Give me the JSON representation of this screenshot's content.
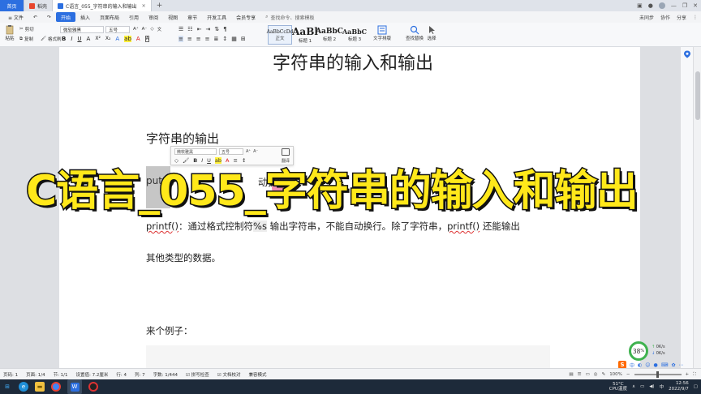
{
  "tabs": {
    "home": "首页",
    "docer": "稻壳",
    "document": "C语言_055_字符串的输入和输出",
    "new_tab": "+"
  },
  "menu": {
    "file": "≡ 文件",
    "start": "开始",
    "items": [
      "插入",
      "页面布局",
      "引用",
      "审阅",
      "视图",
      "章节",
      "开发工具",
      "会员专享"
    ],
    "search_placeholder": "查找命令、搜索模板",
    "right": [
      "未同步",
      "协作",
      "分享"
    ]
  },
  "ribbon": {
    "paste": "粘贴",
    "cut": "剪切",
    "copy": "复制",
    "format_painter": "格式刷",
    "font_name": "微软雅黑",
    "font_size": "五号",
    "styles": [
      {
        "preview": "AaBbCcDd",
        "label": "正文"
      },
      {
        "preview": "AaBl",
        "label": "标题 1"
      },
      {
        "preview": "AaBbC",
        "label": "标题 2"
      },
      {
        "preview": "AaBbC",
        "label": "标题 3"
      }
    ],
    "text_layout": "文字排版",
    "find_replace": "查找替换",
    "select": "选择"
  },
  "document": {
    "title": "字符串的输入和输出",
    "heading": "字符串的输出",
    "puts_line_start": "puts()",
    "puts_line_end": "动换行",
    "printf_line": {
      "func": "printf()",
      "rest_a": "：通过格式控制符",
      "spec": "%s",
      "rest_b": " 输出字符串，不能自动换行。除了字符串，",
      "func2": "printf()",
      "rest_c": " 还能输出"
    },
    "other_types": "其他类型的数据。",
    "example": "来个例子："
  },
  "mini_toolbar": {
    "font": "微软雅黑",
    "size": "五号",
    "translate": "翻译"
  },
  "overlay": {
    "title": "C语言_055_字符串的输入和输出"
  },
  "speed_widget": {
    "percent": "38",
    "unit": "%",
    "up": "0K/s",
    "down": "0K/s"
  },
  "status": {
    "page_num": "页码: 1",
    "pages": "页面: 1/4",
    "section": "节: 1/1",
    "setting": "设置值: 7.2厘米",
    "row": "行: 4",
    "col": "列: 7",
    "words": "字数: 1/444",
    "spell": "拼写检查",
    "proof": "文档校对",
    "compat": "兼容模式",
    "zoom": "100%"
  },
  "ime": {
    "logo": "S",
    "mode": "中"
  },
  "tray": {
    "temp": "51°C",
    "cpu": "CPU温度",
    "lang": "中",
    "time": "12:56",
    "date": "2022/9/7"
  },
  "colors": {
    "accent": "#2c6fe0",
    "overlay_text": "#ffe81a",
    "speed_ring": "#3fb24f"
  }
}
